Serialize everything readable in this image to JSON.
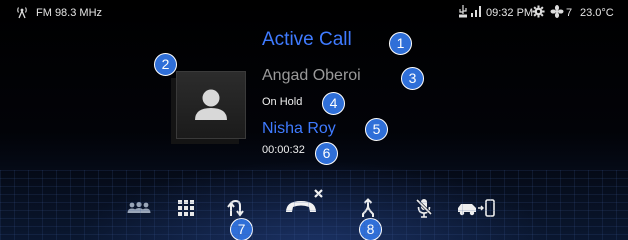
{
  "status_bar": {
    "radio_label": "FM 98.3 MHz",
    "time": "09:32 PM",
    "fan_level": "7",
    "temperature": "23.0°C",
    "icons": [
      "radio-antenna-icon",
      "usb-icon",
      "signal-icon",
      "settings-gear-icon",
      "fan-icon"
    ]
  },
  "call": {
    "title": "Active Call",
    "held_caller": "Angad Oberoi",
    "held_status": "On Hold",
    "active_caller": "Nisha Roy",
    "duration": "00:00:32"
  },
  "toolbar": {
    "buttons": [
      "contacts",
      "keypad",
      "swap-calls",
      "end-call",
      "merge-calls",
      "mute-microphone",
      "transfer-to-phone"
    ]
  },
  "markers": [
    "1",
    "2",
    "3",
    "4",
    "5",
    "6",
    "7",
    "8"
  ],
  "colors": {
    "accent": "#3f7bff",
    "badge": "#2f6fd8"
  }
}
